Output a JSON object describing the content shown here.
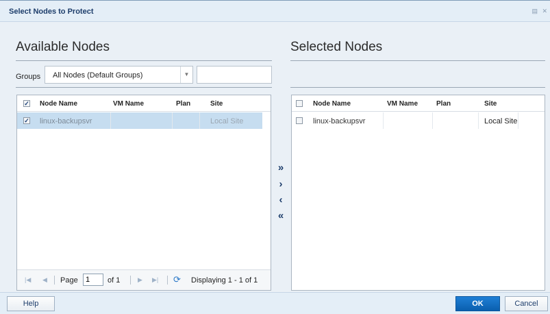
{
  "dialog": {
    "title": "Select Nodes to Protect",
    "header_icons": "▤ ✕"
  },
  "available": {
    "heading": "Available Nodes",
    "groups_label": "Groups",
    "groups_value": "All Nodes (Default Groups)",
    "search_value": "",
    "columns": [
      "Node Name",
      "VM Name",
      "Plan",
      "Site"
    ],
    "header_checked": true,
    "rows": [
      {
        "node_name": "linux-backupsvr",
        "vm_name": "",
        "plan": "",
        "site": "Local Site",
        "checked": true,
        "selected": true
      }
    ]
  },
  "pager": {
    "page_label": "Page",
    "page_value": "1",
    "of_label": "of 1",
    "displaying": "Displaying 1 - 1 of 1"
  },
  "move_buttons": {
    "add_all": "»",
    "add": "›",
    "remove": "‹",
    "remove_all": "«"
  },
  "selected": {
    "heading": "Selected Nodes",
    "columns": [
      "Node Name",
      "VM Name",
      "Plan",
      "Site"
    ],
    "header_checked": false,
    "rows": [
      {
        "node_name": "linux-backupsvr",
        "vm_name": "",
        "plan": "",
        "site": "Local Site",
        "checked": false
      }
    ]
  },
  "footer": {
    "help": "Help",
    "ok": "OK",
    "cancel": "Cancel"
  },
  "icons": {
    "first": "first-page-icon",
    "prev": "previous-page-icon",
    "next": "next-page-icon",
    "last": "last-page-icon",
    "refresh": "refresh-icon"
  }
}
